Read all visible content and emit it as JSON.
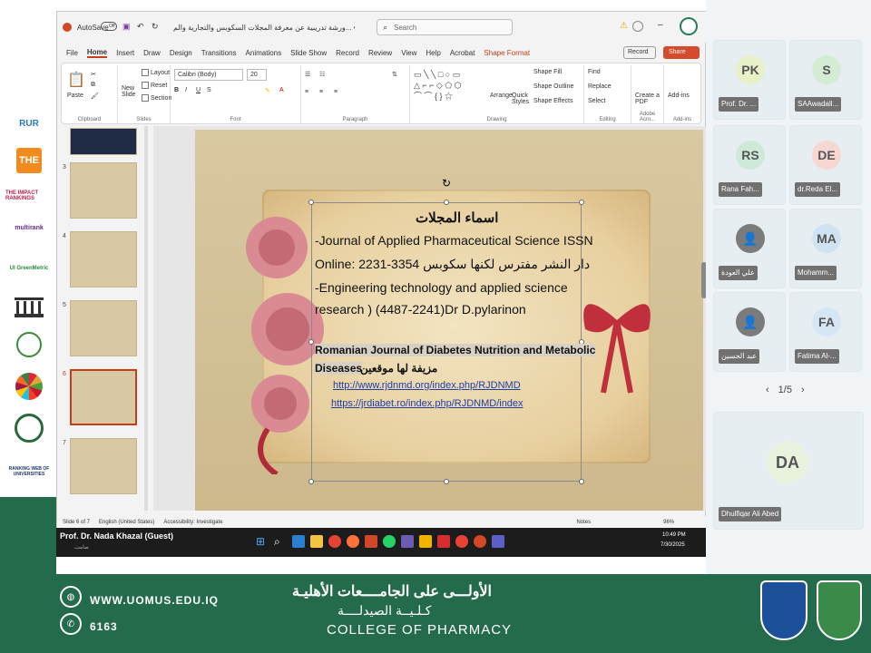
{
  "powerpoint": {
    "autosave_label": "AutoSave",
    "autosave_state": "Off",
    "document_title": "ورشة تدريبية عن معرفة المجلات السكوبس والتجارية والم... • Saved to this PC",
    "search_placeholder": "Search",
    "menu": [
      "File",
      "Home",
      "Insert",
      "Draw",
      "Design",
      "Transitions",
      "Animations",
      "Slide Show",
      "Record",
      "Review",
      "View",
      "Help",
      "Acrobat",
      "Shape Format"
    ],
    "record_label": "Record",
    "share_label": "Share",
    "ribbon_groups": {
      "clipboard": "Clipboard",
      "slides": "Slides",
      "font": "Font",
      "paragraph": "Paragraph",
      "drawing": "Drawing",
      "editing": "Editing",
      "adobe": "Adobe Acro...",
      "addins": "Add-ins"
    },
    "ribbon_buttons": {
      "paste": "Paste",
      "new_slide": "New Slide",
      "layout": "Layout",
      "reset": "Reset",
      "section": "Section",
      "font_name": "Calibri (Body)",
      "font_size": "20",
      "arrange": "Arrange",
      "quick_styles": "Quick Styles",
      "shape_fill": "Shape Fill",
      "shape_outline": "Shape Outline",
      "shape_effects": "Shape Effects",
      "find": "Find",
      "replace": "Replace",
      "select": "Select",
      "create_pdf": "Create a PDF",
      "addins": "Add-ins"
    },
    "thumb_numbers": [
      "3",
      "4",
      "5",
      "6",
      "7"
    ],
    "status": {
      "slide": "Slide 6 of 7",
      "lang": "English (United States)",
      "accessibility": "Accessibility: Investigate",
      "notes": "Notes",
      "zoom": "96%"
    }
  },
  "slide": {
    "heading": "اسماء المجلات",
    "line1": "-Journal of Applied Pharmaceutical Science      ISSN",
    "line2": "Online: 2231-3354 دار النشر مفترس لكنها سكوبس",
    "line3": "-Engineering technology and applied science",
    "line4": "research )  (4487-2241)Dr D.pylarinon",
    "line5": "Romanian Journal of Diabetes Nutrition and Metabolic",
    "line6": "Diseases",
    "line6_arabic": "مزيفة لها موقعين",
    "link1": "http://www.rjdnmd.org/index.php/RJDNMD",
    "link2": "https://jrdiabet.ro/index.php/RJDNMD/index"
  },
  "presenter": {
    "name": "Prof. Dr. Nada Khazal (Guest)",
    "sub": "صامت"
  },
  "taskbar": {
    "time": "10:49 PM",
    "date": "7/30/2025"
  },
  "meeting": {
    "tiles": [
      {
        "initials": "PK",
        "label": "Prof. Dr. ..."
      },
      {
        "initials": "S",
        "label": "SAAwadall..."
      },
      {
        "initials": "RS",
        "label": "Rana Fah..."
      },
      {
        "initials": "DE",
        "label": "dr.Reda El..."
      },
      {
        "initials": "",
        "label": "علي العودة"
      },
      {
        "initials": "MA",
        "label": "Mohamm..."
      },
      {
        "initials": "",
        "label": "عبد الحسين"
      },
      {
        "initials": "FA",
        "label": "Fatima Al-..."
      }
    ],
    "pager": "1/5",
    "speaker_initials": "DA",
    "speaker_label": "Dhulfiqar Ali Abed"
  },
  "footer": {
    "url": "WWW.UOMUS.EDU.IQ",
    "phone": "6163",
    "arabic_university": "الأولـــى على الجامــــعات الأهليـة",
    "arabic_college": "كـلـيــة الصيدلــــة",
    "college": "COLLEGE OF PHARMACY"
  },
  "logos": [
    "RUR",
    "THE",
    "THE IMPACT RANKINGS",
    "multirank",
    "UI GreenMetric",
    "institution",
    "emblem",
    "SDG",
    "Arab federation",
    "RANKING WEB OF UNIVERSITIES"
  ],
  "colors": {
    "brand_green": "#236b4a",
    "share_button": "#d54c2d",
    "link_blue": "#1f3ea8",
    "slide_bg": "#d6c49c"
  }
}
